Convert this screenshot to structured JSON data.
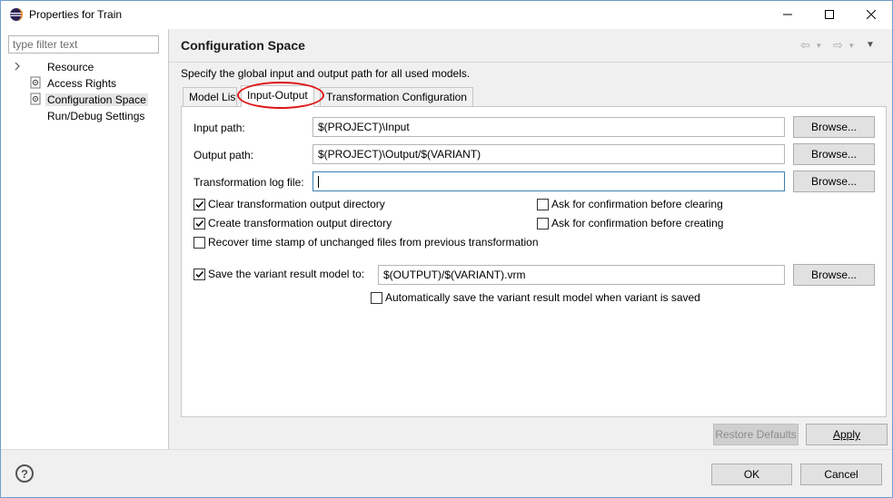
{
  "window": {
    "title": "Properties for Train",
    "minimize_glyph": "—",
    "maximize_glyph": "☐",
    "close_glyph": "✕"
  },
  "sidebar": {
    "filter_placeholder": "type filter text",
    "items": [
      {
        "label": "Resource",
        "expandable": true,
        "icon": "none"
      },
      {
        "label": "Access Rights",
        "expandable": false,
        "icon": "gear-doc-icon"
      },
      {
        "label": "Configuration Space",
        "expandable": false,
        "icon": "gear-doc-icon",
        "selected": true
      },
      {
        "label": "Run/Debug Settings",
        "expandable": false,
        "icon": "none"
      }
    ]
  },
  "page": {
    "title": "Configuration Space",
    "description": "Specify the global input and output path for all used models.",
    "nav": {
      "back": "⇦",
      "forward": "⇨",
      "dropdown": "▾",
      "menu": "▼"
    }
  },
  "tabs": [
    {
      "label": "Model List",
      "active": false
    },
    {
      "label": "Input-Output",
      "active": true
    },
    {
      "label": "Transformation Configuration",
      "active": false
    }
  ],
  "form": {
    "input_path": {
      "label": "Input path:",
      "value": "$(PROJECT)\\Input",
      "browse": "Browse..."
    },
    "output_path": {
      "label": "Output path:",
      "value": "$(PROJECT)\\Output/$(VARIANT)",
      "browse": "Browse..."
    },
    "log_file": {
      "label": "Transformation log file:",
      "value": "",
      "browse": "Browse..."
    },
    "checkboxes": {
      "clear_output": {
        "label": "Clear transformation output directory",
        "checked": true
      },
      "ask_clearing": {
        "label": "Ask for confirmation before clearing",
        "checked": false
      },
      "create_output": {
        "label": "Create transformation output directory",
        "checked": true
      },
      "ask_creating": {
        "label": "Ask for confirmation before creating",
        "checked": false
      },
      "recover_timestamp": {
        "label": "Recover time stamp of unchanged files from previous transformation",
        "checked": false
      },
      "save_variant": {
        "label": "Save the variant result model to:",
        "checked": true
      },
      "auto_save": {
        "label": "Automatically save the variant result model when variant is saved",
        "checked": false
      }
    },
    "variant_model_path": {
      "value": "$(OUTPUT)/$(VARIANT).vrm",
      "browse": "Browse..."
    }
  },
  "buttons": {
    "restore_defaults": "Restore Defaults",
    "apply": "Apply",
    "ok": "OK",
    "cancel": "Cancel",
    "help": "?"
  },
  "colors": {
    "highlight_circle": "#e01717",
    "selected_bg": "#e5e5e5",
    "focus_border": "#3c7fb1"
  }
}
